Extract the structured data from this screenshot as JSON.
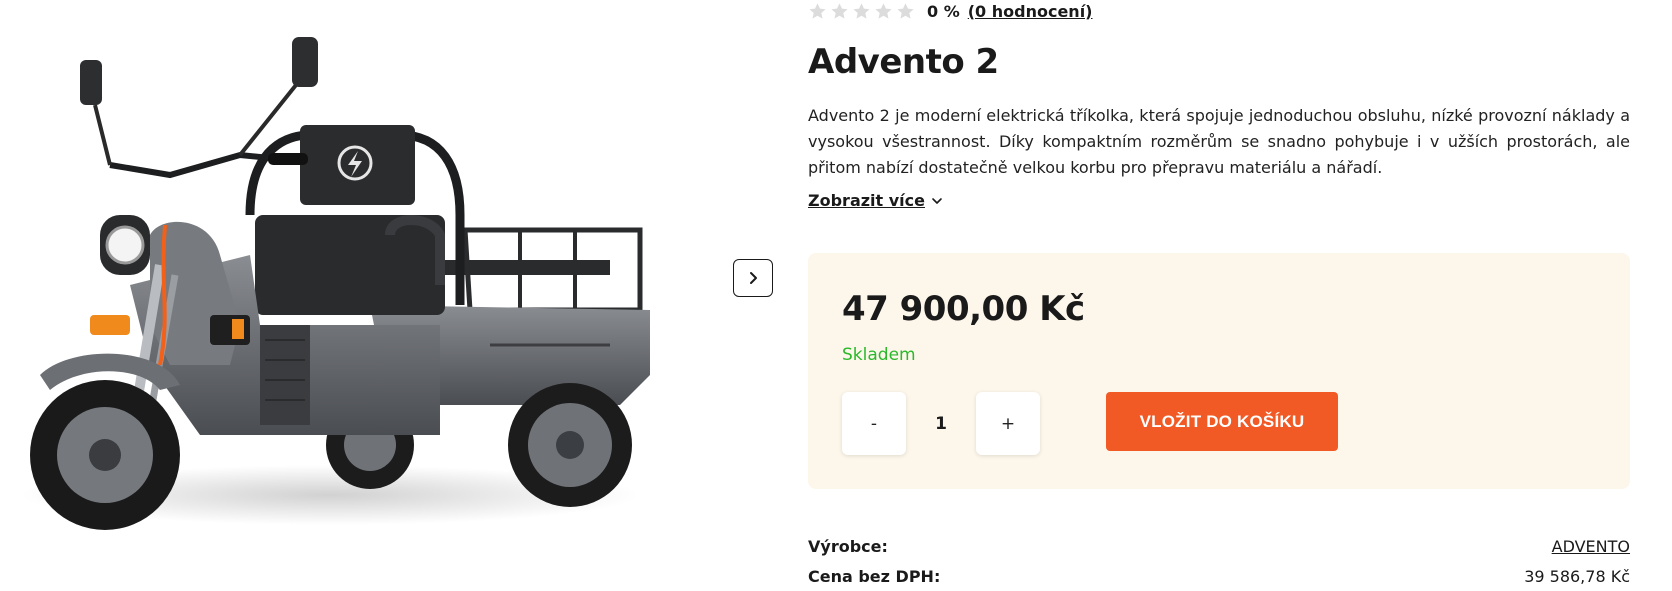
{
  "rating": {
    "percent": "0 %",
    "link_text": "(0 hodnocení)",
    "stars_filled": 0,
    "stars_total": 5
  },
  "product": {
    "title": "Advento 2",
    "description": "Advento 2 je moderní elektrická tříkolka, která spojuje jednoduchou obsluhu, nízké provozní náklady a vysokou všestrannost. Díky kompaktním rozměrům se snadno pohybuje i v užších prostorách, ale přitom nabízí dostatečně velkou korbu pro přepravu materiálu a nářadí.",
    "show_more_label": "Zobrazit více"
  },
  "buybox": {
    "price": "47 900,00 Kč",
    "stock_status": "Skladem",
    "qty_minus": "-",
    "qty_value": "1",
    "qty_plus": "+",
    "add_to_cart_label": "VLOŽIT DO KOŠÍKU"
  },
  "params": [
    {
      "label": "Výrobce:",
      "value": "ADVENTO"
    },
    {
      "label": "Cena bez DPH:",
      "value": "39 586,78 Kč"
    }
  ],
  "icons": {
    "gallery_next": "chevron-right-icon",
    "show_more": "chevron-down-icon",
    "star": "star-icon"
  },
  "colors": {
    "accent": "#f15a24",
    "buybox_bg": "#fdf7eb",
    "in_stock": "#2bb82b",
    "star_empty": "#dcdcdc"
  }
}
